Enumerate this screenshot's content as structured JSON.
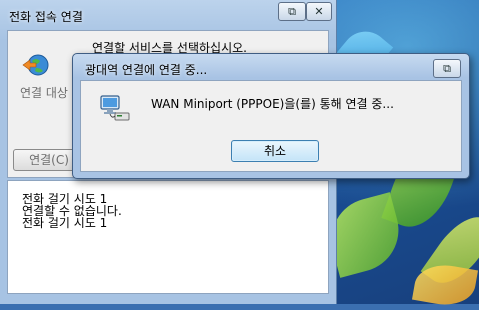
{
  "back_window": {
    "title": "전화 접속 연결",
    "restore_icon": "restore-icon",
    "prompt": "연결할 서비스를 선택하십시오.",
    "connection_label": "연결 대상",
    "connect_button": "연결(C)",
    "log_lines": [
      "전화 걸기 시도 1",
      "연결할 수 없습니다.",
      "전화 걸기 시도 1"
    ]
  },
  "dialog": {
    "title": "광대역 연결에 연결 중...",
    "restore_icon": "restore-icon",
    "message": "WAN Miniport (PPPOE)을(를) 통해 연결 중...",
    "cancel_button": "취소",
    "icon": "network-connection-icon"
  },
  "colors": {
    "title_bar": "#a7c3e3",
    "desktop": "#2c73c6"
  }
}
